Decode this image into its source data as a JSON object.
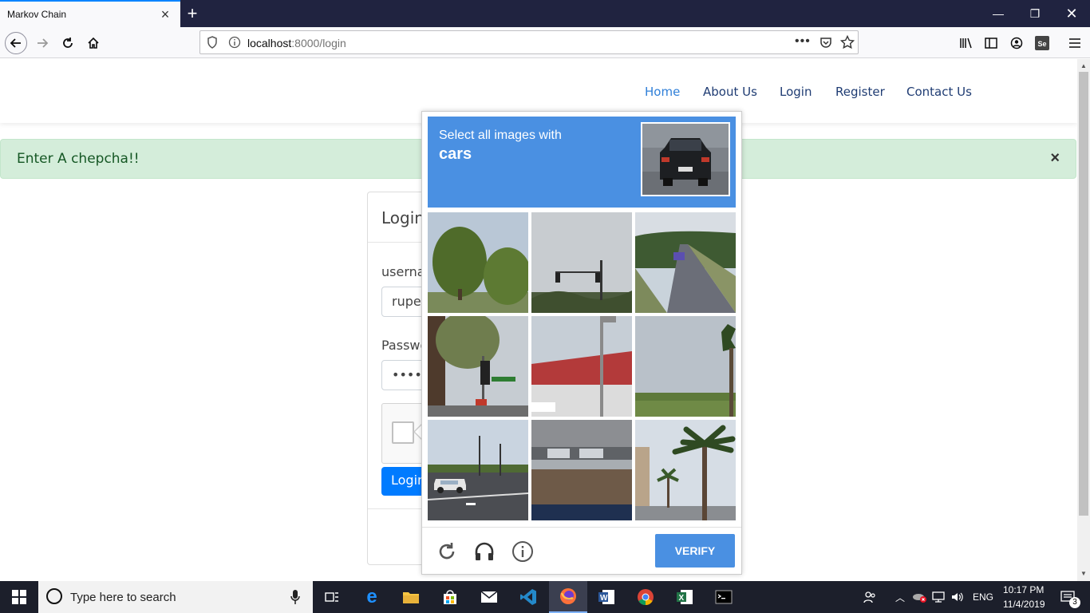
{
  "browser": {
    "tab_title": "Markov Chain",
    "url_host": "localhost",
    "url_rest": ":8000/login"
  },
  "nav": {
    "items": [
      "Home",
      "About Us",
      "Login",
      "Register",
      "Contact Us"
    ]
  },
  "alert": {
    "message": "Enter A chepcha!!",
    "close": "×"
  },
  "login_card": {
    "title": "Login",
    "username_label": "username",
    "username_value": "rupesh",
    "password_label": "Password",
    "password_value": "•••••••",
    "submit_label": "Login"
  },
  "captcha": {
    "instruction": "Select all images with",
    "target": "cars",
    "verify_label": "VERIFY",
    "tiles": [
      "tree",
      "traffic-light",
      "road-car",
      "signal-pole",
      "building-roof",
      "palm-sky",
      "intersection-car",
      "parking-lot",
      "palm-trees"
    ]
  },
  "taskbar": {
    "search_placeholder": "Type here to search",
    "language": "ENG",
    "time": "10:17 PM",
    "date": "11/4/2019",
    "notifications": "3"
  },
  "colors": {
    "captcha_blue": "#4a90e2",
    "alert_green": "#d4edda",
    "primary": "#007bff"
  }
}
